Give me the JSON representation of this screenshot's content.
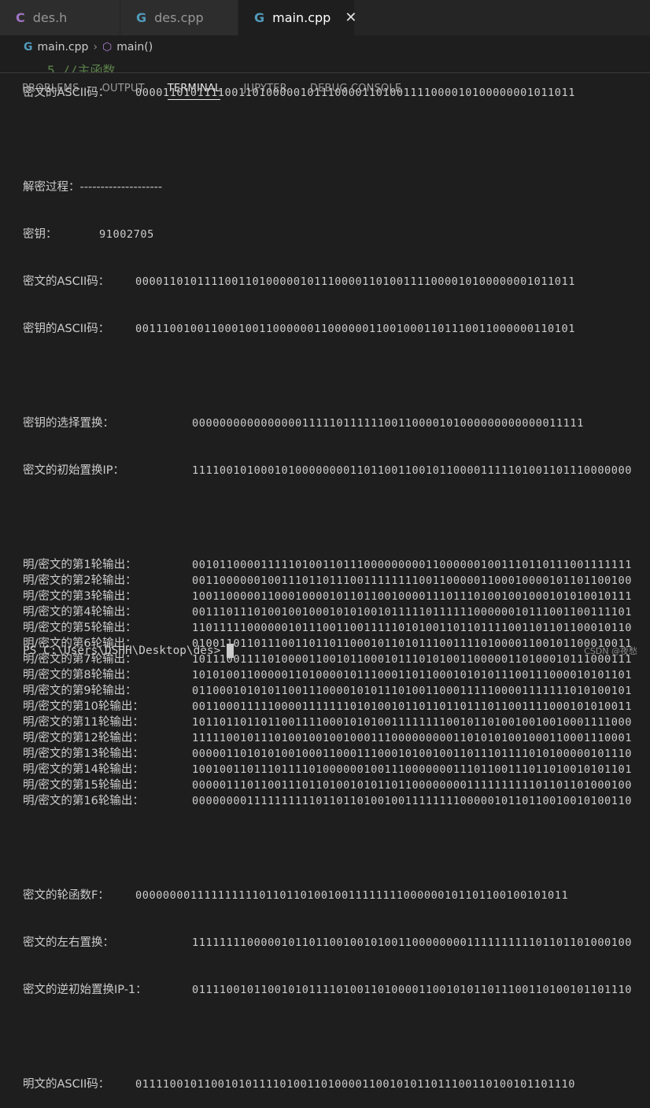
{
  "tabs": [
    {
      "icon": "C",
      "label": "des.h"
    },
    {
      "icon": "G",
      "label": "des.cpp"
    },
    {
      "icon": "G",
      "label": "main.cpp",
      "active": true
    }
  ],
  "breadcrumb": {
    "file": "main.cpp",
    "symbol": "main()"
  },
  "editor_ghost": "5    //主函数",
  "panel_tabs": [
    "PROBLEMS",
    "OUTPUT",
    "TERMINAL",
    "JUPYTER",
    "DEBUG CONSOLE"
  ],
  "terminal": {
    "cipher_ascii_1": {
      "label": "密文的ASCII码：",
      "value": "0000110101111001101000001011100001101001111000010100000001011011"
    },
    "decrypt_header": "解密过程：--------------------",
    "key": {
      "label": "密钥：",
      "value": "91002705"
    },
    "cipher_ascii_2": {
      "label": "密文的ASCII码：",
      "value": "0000110101111001101000001011100001101001111000010100000001011011"
    },
    "key_ascii": {
      "label": "密钥的ASCII码：",
      "value": "0011100100110001001100000011000000110010001101110011000000110101"
    },
    "key_select_perm": {
      "label": "密钥的选择置换：",
      "value": "000000000000000011111011111100110000101000000000000011111"
    },
    "cipher_init_ip": {
      "label": "密文的初始置换IP：",
      "value": "1111001010001010000000011011001100101100001111101001101110000000"
    },
    "rounds": [
      {
        "label": "明/密文的第1轮输出：",
        "value": "0010110000111110100110111000000000110000001001110110111001111111"
      },
      {
        "label": "明/密文的第2轮输出：",
        "value": "0011000000100111011011100111111110011000001100010000101101100100"
      },
      {
        "label": "明/密文的第3轮输出：",
        "value": "1001100000110001000010110110010000111011101001001000101010010111"
      },
      {
        "label": "明/密文的第4轮输出：",
        "value": "0011101110100100100010101001011111011111100000010111001100111101"
      },
      {
        "label": "明/密文的第5轮输出：",
        "value": "1101111100000010111001100111110101001101101111001101101100010110"
      },
      {
        "label": "明/密文的第6轮输出：",
        "value": "0100110110111001101101100010110101110011110100001100101100010011"
      },
      {
        "label": "明/密文的第7轮输出：",
        "value": "1011100111101000011001011000101110101001100000110100010111000111"
      },
      {
        "label": "明/密文的第8轮输出：",
        "value": "1010100110000011010000101110001101100010101011100111000010101101"
      },
      {
        "label": "明/密文的第9轮输出：",
        "value": "0110001010101100111000010101110100110001111100001111111010100101"
      },
      {
        "label": "明/密文的第10轮输出：",
        "value": "0011000111110000111111101010010110110110111011001111000101010011"
      },
      {
        "label": "明/密文的第11轮输出：",
        "value": "1011011011011001111000101010011111111001011010010010010001111000"
      },
      {
        "label": "明/密文的第12轮输出：",
        "value": "1111100101110100100100100011100000000011010101001000110001110001"
      },
      {
        "label": "明/密文的第13轮输出：",
        "value": "0000011010101001000110001110001010010011011101111010100000101110"
      },
      {
        "label": "明/密文的第14轮输出：",
        "value": "1001001101110111101000000100111000000011101100111011010010101101"
      },
      {
        "label": "明/密文的第15轮输出：",
        "value": "0000011101100111011010010101101100000000111111111101101101000100"
      },
      {
        "label": "明/密文的第16轮输出：",
        "value": "0000000011111111110110110100100111111110000010110110010010100110"
      }
    ],
    "round_func": {
      "label": "密文的轮函数F：",
      "value": "000000001111111111011011010010011111111000000101101100100101011"
    },
    "lr_swap": {
      "label": "密文的左右置换：",
      "value": "1111111100000101101100100101001100000000111111111101101101000100"
    },
    "inv_ip": {
      "label": "密文的逆初始置换IP-1：",
      "value": "0111100101100101011110100110100001100101011011100110100101101110"
    },
    "plain_ascii": {
      "label": "明文的ASCII码：",
      "value": "0111100101100101011110100110100001100101011011100110100101101110"
    },
    "prompt": "PS C:\\Users\\DSHH\\Desktop\\des>"
  },
  "watermark": "CSDN @夜愁"
}
